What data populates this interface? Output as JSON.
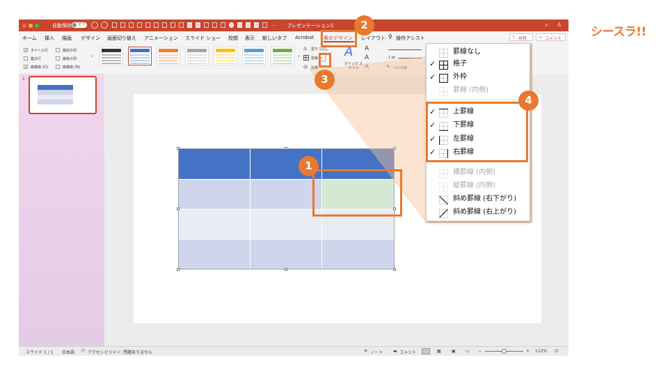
{
  "brand": {
    "logo_text": "シースラ!!",
    "accent": "#e8792f"
  },
  "titlebar": {
    "autosave_label": "自動保存",
    "autosave_state": "オフ",
    "doc_title": "プレゼンテーション1",
    "ellipsis": "…"
  },
  "menu": {
    "items": [
      "ホーム",
      "挿入",
      "描画",
      "デザイン",
      "画面切り替え",
      "アニメーション",
      "スライド ショー",
      "校閲",
      "表示",
      "新しいタブ",
      "Acrobat",
      "表のデザイン",
      "レイアウト"
    ],
    "active": "表のデザイン",
    "tell_me": "操作アシスト",
    "share": "共有",
    "comment": "コメント"
  },
  "ribbon": {
    "options": [
      {
        "label": "タイトル行",
        "checked": true
      },
      {
        "label": "最初の列",
        "checked": false
      },
      {
        "label": "集計行",
        "checked": false
      },
      {
        "label": "最後の列",
        "checked": false
      },
      {
        "label": "縞模様 (行)",
        "checked": true
      },
      {
        "label": "縞模様 (列)",
        "checked": false
      }
    ],
    "style_colors": [
      "#333333",
      "#4472c4",
      "#ed7d31",
      "#a5a5a5",
      "#ffc000",
      "#5b9bd5",
      "#70ad47"
    ],
    "shading_label": "塗りつぶし",
    "borders_label": "罫線",
    "effects_label": "効果",
    "quick_styles_label": "クイック スタイル",
    "pen_weight": "1 pt",
    "pen_color_label": "ペンの色"
  },
  "sidebar": {
    "slide_number": "1"
  },
  "borders_menu": {
    "items": [
      {
        "label": "罫線なし",
        "checked": false,
        "disabled": false,
        "icon": "no-border-icon"
      },
      {
        "label": "格子",
        "checked": true,
        "disabled": false,
        "icon": "all-borders-icon"
      },
      {
        "label": "外枠",
        "checked": true,
        "disabled": false,
        "icon": "outside-borders-icon"
      },
      {
        "label": "罫線 (内側)",
        "checked": false,
        "disabled": true,
        "icon": "inside-borders-icon"
      },
      {
        "label": "上罫線",
        "checked": true,
        "disabled": false,
        "icon": "top-border-icon"
      },
      {
        "label": "下罫線",
        "checked": true,
        "disabled": false,
        "icon": "bottom-border-icon"
      },
      {
        "label": "左罫線",
        "checked": true,
        "disabled": false,
        "icon": "left-border-icon"
      },
      {
        "label": "右罫線",
        "checked": true,
        "disabled": false,
        "icon": "right-border-icon"
      },
      {
        "label": "横罫線 (内側)",
        "checked": false,
        "disabled": true,
        "icon": "inside-horizontal-border-icon"
      },
      {
        "label": "縦罫線 (内側)",
        "checked": false,
        "disabled": true,
        "icon": "inside-vertical-border-icon"
      },
      {
        "label": "斜め罫線 (右下がり)",
        "checked": false,
        "disabled": false,
        "icon": "diagonal-down-border-icon"
      },
      {
        "label": "斜め罫線 (右上がり)",
        "checked": false,
        "disabled": false,
        "icon": "diagonal-up-border-icon"
      }
    ]
  },
  "callouts": [
    "1",
    "2",
    "3",
    "4"
  ],
  "status": {
    "slide": "スライド 1 / 1",
    "language": "日本語",
    "accessibility": "アクセシビリティ: 問題ありません",
    "notes": "ノート",
    "comments": "コメント",
    "zoom": "112%"
  },
  "colors": {
    "titlebar": "#c8452e",
    "table_header": "#4472c4",
    "table_band_dark": "#cfd5ea",
    "table_band_light": "#e9ebf5",
    "selected_cell": "#d5e8d4",
    "callout": "#e8792f"
  }
}
